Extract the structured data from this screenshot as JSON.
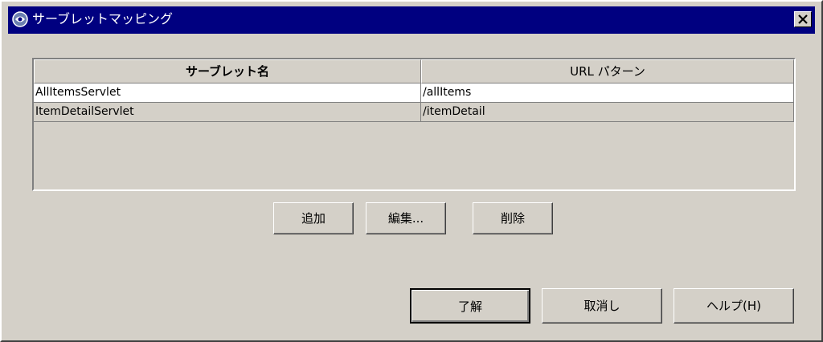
{
  "window": {
    "title": "サーブレットマッピング",
    "close_label": "×"
  },
  "table": {
    "columns": [
      "サーブレット名",
      "URL パターン"
    ],
    "rows": [
      [
        "AllItemsServlet",
        "/allItems"
      ],
      [
        "ItemDetailServlet",
        "/itemDetail"
      ]
    ],
    "selected_row": 0
  },
  "actions": {
    "add": "追加",
    "edit": "編集...",
    "delete": "削除"
  },
  "footer": {
    "ok": "了解",
    "cancel": "取消し",
    "help": "ヘルプ(H)"
  },
  "colors": {
    "titlebar": "#000080",
    "face": "#d4d0c8",
    "selected_row": "#ffffff"
  }
}
